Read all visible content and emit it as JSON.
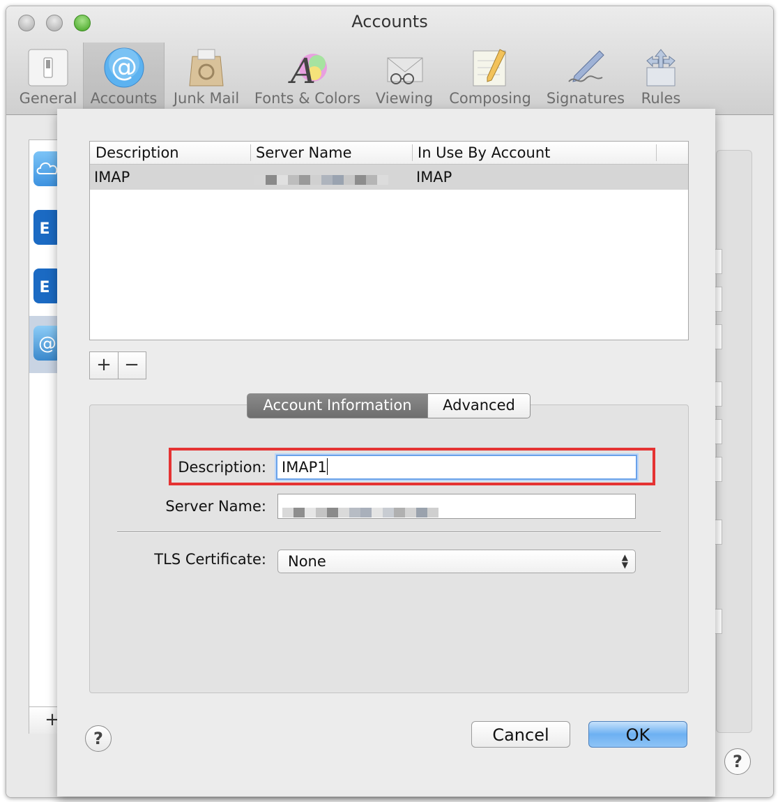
{
  "window": {
    "title": "Accounts"
  },
  "toolbar": {
    "items": [
      {
        "label": "General",
        "icon": "switch-icon"
      },
      {
        "label": "Accounts",
        "icon": "at-sign-icon"
      },
      {
        "label": "Junk Mail",
        "icon": "recycle-bag-icon"
      },
      {
        "label": "Fonts & Colors",
        "icon": "color-letter-icon"
      },
      {
        "label": "Viewing",
        "icon": "glasses-envelope-icon"
      },
      {
        "label": "Composing",
        "icon": "pencil-paper-icon"
      },
      {
        "label": "Signatures",
        "icon": "pen-signature-icon"
      },
      {
        "label": "Rules",
        "icon": "rules-arrows-icon"
      }
    ],
    "selected": "Accounts"
  },
  "background": {
    "add_label": "+",
    "help_label": "?"
  },
  "sheet": {
    "table": {
      "columns": [
        "Description",
        "Server Name",
        "In Use By Account"
      ],
      "rows": [
        {
          "description": "IMAP",
          "server_name": "",
          "in_use_by": "IMAP"
        }
      ]
    },
    "add_button": "+",
    "remove_button": "−",
    "tabs": {
      "account_info": "Account Information",
      "advanced": "Advanced",
      "selected": "Account Information"
    },
    "fields": {
      "description_label": "Description:",
      "description_value": "IMAP1",
      "server_name_label": "Server Name:",
      "server_name_value": "",
      "tls_label": "TLS Certificate:",
      "tls_value": "None"
    },
    "help_label": "?",
    "cancel_label": "Cancel",
    "ok_label": "OK"
  },
  "colors": {
    "highlight_box": "#e53333",
    "ok_button": "#6db0f2",
    "focus_ring": "#6aa2ea"
  }
}
